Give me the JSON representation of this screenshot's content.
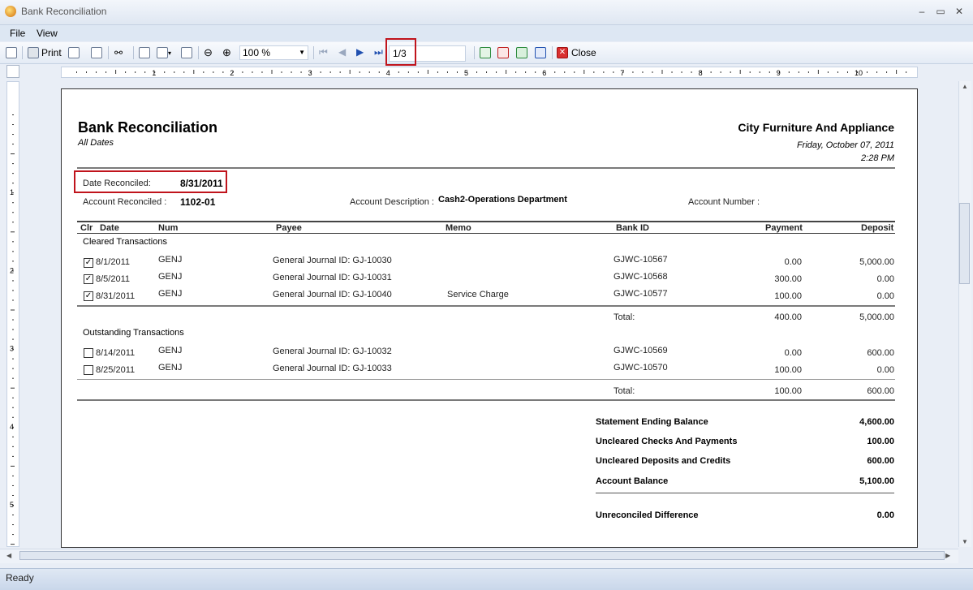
{
  "window": {
    "title": "Bank Reconciliation"
  },
  "menu": [
    "File",
    "View"
  ],
  "toolbar": {
    "print_label": "Print",
    "zoom": "100 %",
    "page": "1/3",
    "close_label": "Close"
  },
  "status": "Ready",
  "report": {
    "title": "Bank Reconciliation",
    "subtitle": "All Dates",
    "company": "City Furniture And Appliance",
    "date": "Friday, October 07, 2011",
    "time": "2:28 PM",
    "date_reconciled_label": "Date Reconciled:",
    "date_reconciled": "8/31/2011",
    "account_reconciled_label": "Account Reconciled :",
    "account_reconciled": "1102-01",
    "account_description_label": "Account Description :",
    "account_description": "Cash2-Operations Department",
    "account_number_label": "Account Number :",
    "columns": [
      "Clr",
      "Date",
      "Num",
      "Payee",
      "Memo",
      "Bank ID",
      "Payment",
      "Deposit"
    ],
    "cleared_label": "Cleared Transactions",
    "cleared": [
      {
        "checked": true,
        "date": "8/1/2011",
        "num": "GENJ",
        "payee": "General Journal ID: GJ-10030",
        "memo": "",
        "bank_id": "GJWC-10567",
        "payment": "0.00",
        "deposit": "5,000.00"
      },
      {
        "checked": true,
        "date": "8/5/2011",
        "num": "GENJ",
        "payee": "General Journal ID: GJ-10031",
        "memo": "",
        "bank_id": "GJWC-10568",
        "payment": "300.00",
        "deposit": "0.00"
      },
      {
        "checked": true,
        "date": "8/31/2011",
        "num": "GENJ",
        "payee": "General Journal ID: GJ-10040",
        "memo": "Service Charge",
        "bank_id": "GJWC-10577",
        "payment": "100.00",
        "deposit": "0.00"
      }
    ],
    "cleared_total": {
      "label": "Total:",
      "payment": "400.00",
      "deposit": "5,000.00"
    },
    "outstanding_label": "Outstanding Transactions",
    "outstanding": [
      {
        "checked": false,
        "date": "8/14/2011",
        "num": "GENJ",
        "payee": "General Journal ID: GJ-10032",
        "memo": "",
        "bank_id": "GJWC-10569",
        "payment": "0.00",
        "deposit": "600.00"
      },
      {
        "checked": false,
        "date": "8/25/2011",
        "num": "GENJ",
        "payee": "General Journal ID: GJ-10033",
        "memo": "",
        "bank_id": "GJWC-10570",
        "payment": "100.00",
        "deposit": "0.00"
      }
    ],
    "outstanding_total": {
      "label": "Total:",
      "payment": "100.00",
      "deposit": "600.00"
    },
    "summary": {
      "statement_ending_balance_label": "Statement Ending Balance",
      "statement_ending_balance": "4,600.00",
      "uncleared_checks_label": "Uncleared Checks And Payments",
      "uncleared_checks": "100.00",
      "uncleared_deposits_label": "Uncleared Deposits and Credits",
      "uncleared_deposits": "600.00",
      "account_balance_label": "Account Balance",
      "account_balance": "5,100.00",
      "unreconciled_label": "Unreconciled Difference",
      "unreconciled": "0.00"
    }
  },
  "ruler": {
    "h_labels": [
      "1",
      "2",
      "3",
      "4",
      "5",
      "6",
      "7",
      "8",
      "9",
      "10"
    ],
    "v_labels": [
      "1",
      "2",
      "3",
      "4",
      "5"
    ]
  }
}
